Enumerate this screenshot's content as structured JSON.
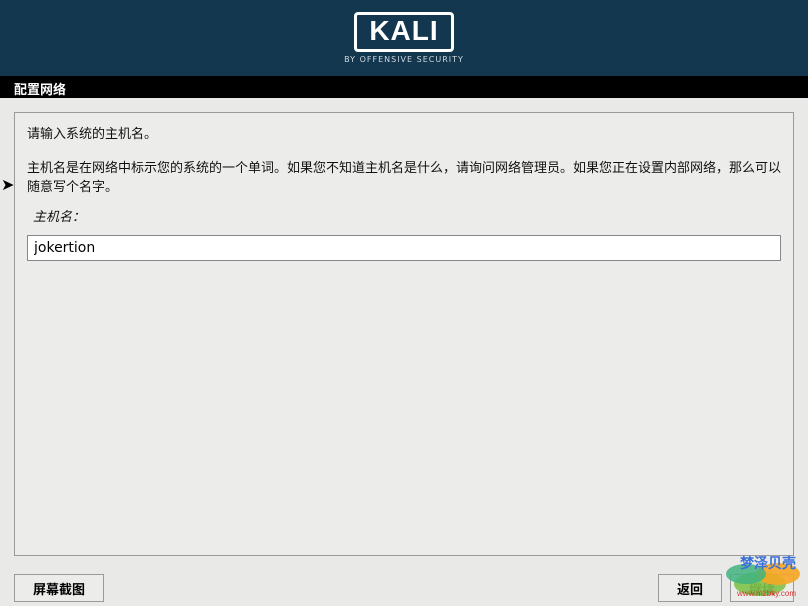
{
  "logo": {
    "title": "KALI",
    "subtitle": "BY OFFENSIVE SECURITY"
  },
  "section_title": "配置网络",
  "intro": "请输入系统的主机名。",
  "description": "主机名是在网络中标示您的系统的一个单词。如果您不知道主机名是什么，请询问网络管理员。如果您正在设置内部网络，那么可以随意写个名字。",
  "field_label": "主机名：",
  "hostname_value": "jokertion",
  "buttons": {
    "screenshot": "屏幕截图",
    "back": "返回",
    "continue": "继续"
  },
  "watermark": {
    "text": "梦泽贝壳",
    "sub": "www.mzbky.com"
  }
}
